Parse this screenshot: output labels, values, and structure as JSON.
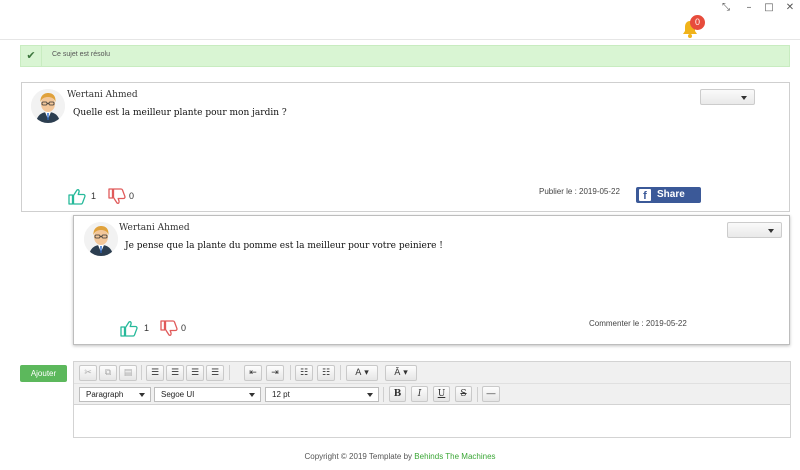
{
  "window": {
    "buttons": [
      "⤡",
      "–",
      "□",
      "✕"
    ],
    "notifications_count": "0"
  },
  "alert": {
    "text": "Ce sujet est résolu",
    "color": "#d9f5d3"
  },
  "post": {
    "author": "Wertani Ahmed",
    "content": "Quelle est la meilleur plante pour mon jardin ?",
    "likes": "1",
    "dislikes": "0",
    "date_label": "Publier le : 2019-05-22",
    "share_label": "Share"
  },
  "comment": {
    "author": "Wertani Ahmed",
    "content": "Je pense que la plante du pomme est la meilleur pour votre peiniere !",
    "likes": "1",
    "dislikes": "0",
    "date_label": "Commenter le : 2019-05-22"
  },
  "add_button": {
    "label": "Ajouter",
    "color": "#5cb85c"
  },
  "editor": {
    "block_format": "Paragraph",
    "font_family": "Segoe UI",
    "font_size": "12 pt",
    "toolbar_row1_icons": [
      "cut-icon",
      "copy-icon",
      "paste-icon",
      "align-left-icon",
      "align-center-icon",
      "align-right-icon",
      "align-justify-icon",
      "outdent-icon",
      "indent-icon",
      "bullet-list-icon",
      "numbered-list-icon",
      "font-color-icon",
      "highlight-icon"
    ],
    "bold": "B",
    "italic": "I",
    "underline": "U",
    "strike": "S"
  },
  "footer": {
    "text": "Copyright © 2019 Template by",
    "brand": "Behinds The Machines"
  },
  "colors": {
    "like": "#26b99a",
    "dislike": "#e05a5a",
    "facebook": "#3b5998"
  }
}
